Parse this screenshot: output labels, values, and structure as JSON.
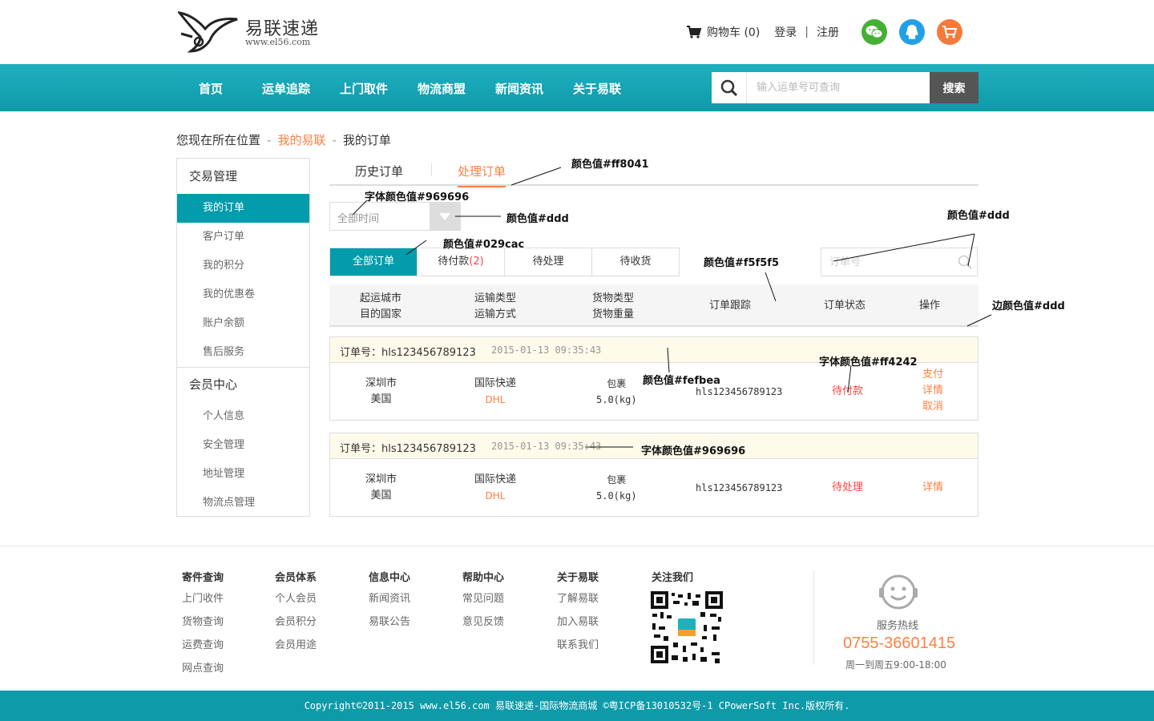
{
  "header": {
    "logo_name": "易联速递",
    "logo_url": "www.el56.com",
    "cart_label": "购物车 (0)",
    "login": "登录",
    "sep": "|",
    "register": "注册"
  },
  "nav": {
    "items": [
      "首页",
      "运单追踪",
      "上门取件",
      "物流商盟",
      "新闻资讯",
      "关于易联"
    ],
    "search_placeholder": "输入运单号可查询",
    "search_button": "搜索"
  },
  "breadcrumb": {
    "prefix": "您现在所在位置",
    "dash": "-",
    "level1": "我的易联",
    "level2": "我的订单"
  },
  "sidebar": {
    "group1": "交易管理",
    "group1_items": [
      "我的订单",
      "客户订单",
      "我的积分",
      "我的优惠卷",
      "账户余额",
      "售后服务"
    ],
    "group2": "会员中心",
    "group2_items": [
      "个人信息",
      "安全管理",
      "地址管理",
      "物流点管理"
    ]
  },
  "tabs": {
    "history": "历史订单",
    "processing": "处理订单"
  },
  "filter": {
    "select_value": "全部时间",
    "search_placeholder": "订单号"
  },
  "status_tabs": {
    "all": "全部订单",
    "pending_pay": "待付款",
    "pending_pay_count": "(2)",
    "pending_process": "待处理",
    "pending_receive": "待收货"
  },
  "table_header": {
    "origin": "起运城市",
    "dest": "目的国家",
    "transport_type": "运输类型",
    "transport_mode": "运输方式",
    "goods_type": "货物类型",
    "goods_weight": "货物重量",
    "tracking": "订单跟踪",
    "status": "订单状态",
    "action": "操作"
  },
  "orders": [
    {
      "no": "订单号：hls123456789123",
      "time": "2015-01-13 09:35:43",
      "origin": "深圳市",
      "dest": "美国",
      "type": "国际快递",
      "mode": "DHL",
      "goods": "包裹",
      "weight": "5.0(kg)",
      "tracking": "hls123456789123",
      "status": "待付款",
      "actions": [
        "支付",
        "详情",
        "取消"
      ]
    },
    {
      "no": "订单号：hls123456789123",
      "time": "2015-01-13 09:35:43",
      "origin": "深圳市",
      "dest": "美国",
      "type": "国际快递",
      "mode": "DHL",
      "goods": "包裹",
      "weight": "5.0(kg)",
      "tracking": "hls123456789123",
      "status": "待处理",
      "actions": [
        "详情"
      ]
    }
  ],
  "annotations": {
    "a1": "颜色值#ff8041",
    "a2": "字体颜色值#969696",
    "a3": "颜色值#ddd",
    "a4": "颜色值#029cac",
    "a5": "颜色值#ddd",
    "a6": "颜色值#f5f5f5",
    "a7": "边颜色值#ddd",
    "a8": "字体颜色值#ff4242",
    "a9": "颜色值#fefbea",
    "a10": "字体颜色值#969696"
  },
  "footer": {
    "col1": {
      "head": "寄件查询",
      "links": [
        "上门收件",
        "货物查询",
        "运费查询",
        "网点查询"
      ]
    },
    "col2": {
      "head": "会员体系",
      "links": [
        "个人会员",
        "会员积分",
        "会员用途"
      ]
    },
    "col3": {
      "head": "信息中心",
      "links": [
        "新闻资讯",
        "易联公告"
      ]
    },
    "col4": {
      "head": "帮助中心",
      "links": [
        "常见问题",
        "意见反馈"
      ]
    },
    "col5": {
      "head": "关于易联",
      "links": [
        "了解易联",
        "加入易联",
        "联系我们"
      ]
    },
    "col6": {
      "head": "关注我们"
    },
    "hotline_label": "服务热线",
    "hotline_number": "0755-36601415",
    "hotline_hours": "周一到周五9:00-18:00",
    "copyright": "Copyright©2011-2015 www.el56.com 易联速递-国际物流商城 ©粤ICP备13010532号-1 CPowerSoft Inc.版权所有."
  },
  "colors": {
    "teal": "#029cac",
    "orange": "#ff8041",
    "red": "#ff4242",
    "border": "#ddd",
    "head_bg": "#f5f5f5",
    "order_head_bg": "#fefbea",
    "gray_text": "#969696"
  }
}
